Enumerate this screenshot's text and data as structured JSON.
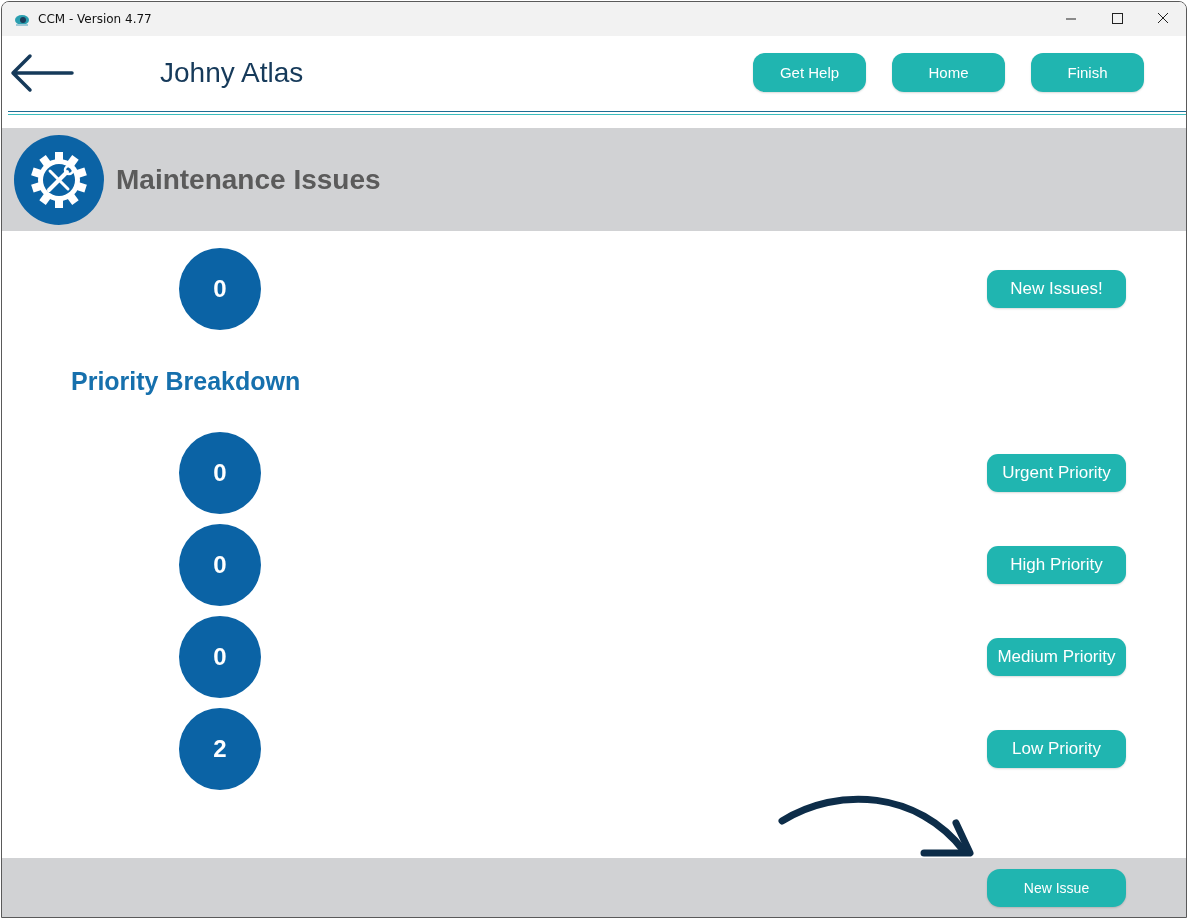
{
  "window": {
    "title": "CCM - Version 4.77"
  },
  "header": {
    "user_name": "Johny Atlas",
    "buttons": [
      "Get Help",
      "Home",
      "Finish"
    ]
  },
  "section": {
    "title": "Maintenance Issues"
  },
  "summary": {
    "count": "0",
    "button": "New Issues!"
  },
  "breakdown": {
    "title": "Priority Breakdown",
    "rows": [
      {
        "count": "0",
        "button": "Urgent Priority"
      },
      {
        "count": "0",
        "button": "High Priority"
      },
      {
        "count": "0",
        "button": "Medium Priority"
      },
      {
        "count": "2",
        "button": "Low Priority"
      }
    ]
  },
  "footer": {
    "button": "New Issue"
  }
}
